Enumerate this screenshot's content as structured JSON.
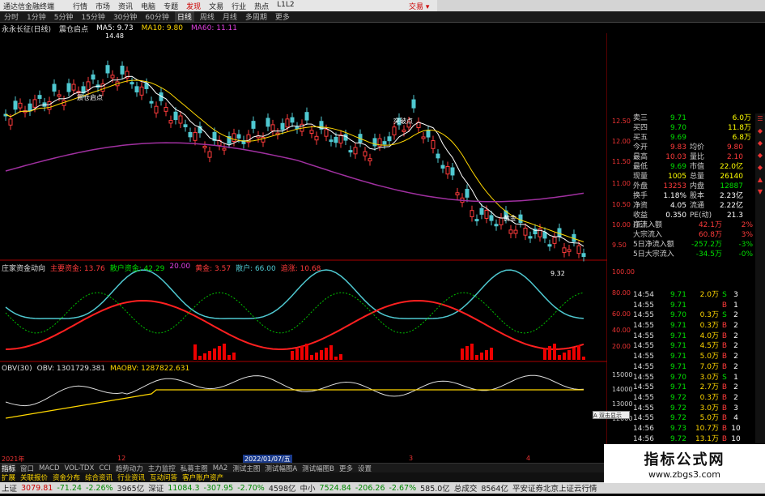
{
  "titlebar": {
    "app_name": "通达信金融终端",
    "menu": [
      "行情",
      "市场",
      "资讯",
      "电脑",
      "专题",
      "发现",
      "文易",
      "行业",
      "热点",
      "L1L2"
    ],
    "menu_active_index": 5,
    "trade_label": "交易 ▾"
  },
  "toolbar": {
    "items": [
      "分时",
      "1分钟",
      "5分钟",
      "15分钟",
      "30分钟",
      "60分钟",
      "日线",
      "周线",
      "月线",
      "多周期",
      "更多"
    ],
    "selected_index": 6
  },
  "ma_line": {
    "stock": "永永长征(日线)",
    "indicator": "震仓启点",
    "ma5": "MA5: 9.73",
    "ma10": "MA10: 9.80",
    "ma60": "MA60: 11.11"
  },
  "price_axis": [
    "12.50",
    "12.00",
    "11.50",
    "11.00",
    "10.50",
    "10.00",
    "9.50"
  ],
  "annotations": {
    "high": "14.48",
    "low": "9.32",
    "label_a": "震仓启点",
    "label_b": "突破点",
    "label_c": "黄金"
  },
  "quote": {
    "rows": [
      {
        "k": "卖三",
        "v": "9.71",
        "v_color": "green",
        "q": "6.0万"
      },
      {
        "k": "买四",
        "v": "9.70",
        "v_color": "green",
        "q": "11.8万"
      },
      {
        "k": "买五",
        "v": "9.69",
        "v_color": "green",
        "q": "6.8万"
      }
    ],
    "stats": [
      {
        "k": "今开",
        "v": "9.83",
        "v_color": "red",
        "k2": "均价",
        "v2": "9.80",
        "v2_color": "red"
      },
      {
        "k": "最高",
        "v": "10.03",
        "v_color": "red",
        "k2": "量比",
        "v2": "2.10",
        "v2_color": "red"
      },
      {
        "k": "最低",
        "v": "9.69",
        "v_color": "green",
        "k2": "市值",
        "v2": "22.0亿",
        "v2_color": "yellow"
      },
      {
        "k": "现量",
        "v": "1005",
        "v_color": "yellow",
        "k2": "总量",
        "v2": "26140",
        "v2_color": "yellow"
      },
      {
        "k": "外盘",
        "v": "13253",
        "v_color": "red",
        "k2": "内盘",
        "v2": "12887",
        "v2_color": "green"
      },
      {
        "k": "换手",
        "v": "1.18%",
        "v_color": "white",
        "k2": "股本",
        "v2": "2.23亿",
        "v2_color": "white"
      },
      {
        "k": "净资",
        "v": "4.05",
        "v_color": "white",
        "k2": "流通",
        "v2": "2.22亿",
        "v2_color": "white"
      },
      {
        "k": "收益(三)",
        "v": "0.350",
        "v_color": "white",
        "k2": "PE(动)",
        "v2": "21.3",
        "v2_color": "white"
      }
    ],
    "flows": [
      {
        "k": "净流入额",
        "v": "42.1万",
        "pct": "2%",
        "color": "red"
      },
      {
        "k": "大宗流入",
        "v": "60.8万",
        "pct": "3%",
        "color": "red"
      },
      {
        "k": "5日净流入额",
        "v": "-257.2万",
        "pct": "-3%",
        "color": "green"
      },
      {
        "k": "5日大宗流入",
        "v": "-34.5万",
        "pct": "-0%",
        "color": "green"
      }
    ]
  },
  "trades": [
    {
      "t": "14:54",
      "p": "9.71",
      "q": "2.0万",
      "d": "S",
      "n": "3"
    },
    {
      "t": "14:55",
      "p": "9.71",
      "q": "",
      "d": "B",
      "n": "1"
    },
    {
      "t": "14:55",
      "p": "9.70",
      "q": "0.3万",
      "d": "S",
      "n": "2"
    },
    {
      "t": "14:55",
      "p": "9.71",
      "q": "0.3万",
      "d": "B",
      "n": "2"
    },
    {
      "t": "14:55",
      "p": "9.71",
      "q": "4.0万",
      "d": "B",
      "n": "2"
    },
    {
      "t": "14:55",
      "p": "9.71",
      "q": "4.5万",
      "d": "B",
      "n": "2"
    },
    {
      "t": "14:55",
      "p": "9.71",
      "q": "5.0万",
      "d": "B",
      "n": "2"
    },
    {
      "t": "14:55",
      "p": "9.71",
      "q": "7.0万",
      "d": "B",
      "n": "2"
    },
    {
      "t": "14:55",
      "p": "9.70",
      "q": "3.0万",
      "d": "S",
      "n": "1"
    },
    {
      "t": "14:55",
      "p": "9.71",
      "q": "2.7万",
      "d": "B",
      "n": "2"
    },
    {
      "t": "14:55",
      "p": "9.72",
      "q": "0.3万",
      "d": "B",
      "n": "2"
    },
    {
      "t": "14:55",
      "p": "9.72",
      "q": "3.0万",
      "d": "B",
      "n": "3"
    },
    {
      "t": "14:55",
      "p": "9.72",
      "q": "5.0万",
      "d": "B",
      "n": "4"
    },
    {
      "t": "14:56",
      "p": "9.73",
      "q": "10.7万",
      "d": "B",
      "n": "10"
    },
    {
      "t": "14:56",
      "p": "9.72",
      "q": "13.1万",
      "d": "B",
      "n": "10"
    },
    {
      "t": "14:56",
      "p": "9.72",
      "q": "17.5万",
      "d": "B",
      "n": "2"
    },
    {
      "t": "14:56",
      "p": "9.72",
      "q": "10.0万",
      "d": "B",
      "n": "2"
    },
    {
      "t": "14:56",
      "p": "9.72",
      "q": "8.5万",
      "d": "B",
      "n": "2"
    },
    {
      "t": "14:56",
      "p": "9.70",
      "q": "18.3万",
      "d": "S",
      "n": "2"
    },
    {
      "t": "14:56",
      "p": "9.71",
      "q": "11.1万",
      "d": "B",
      "n": "4"
    }
  ],
  "fund_panel": {
    "title": "庄家资金动向",
    "main_in_label": "主要资金: 13.76",
    "retail_label": "散户资金: 42.29",
    "v20": "20.00",
    "v_huangjin": "黄金: 3.57",
    "v_sanhu": "散户: 66.00",
    "v_zhuli": "追涨: 10.68",
    "axis": [
      "100.00",
      "80.00",
      "60.00",
      "40.00",
      "20.00"
    ]
  },
  "obv_panel": {
    "title": "OBV(30)",
    "obv": "OBV: 1301729.381",
    "maobv": "MAOBV: 1287822.631",
    "axis": [
      "15000",
      "14000",
      "13000",
      "12000"
    ]
  },
  "dates": {
    "d1": "2021年",
    "d2": "12",
    "d3": "2022/01/07/五",
    "d4": "3",
    "d5": "4"
  },
  "bottom_tabs": [
    "指标",
    "窗口",
    "MACD",
    "VOL-TDX",
    "CCI",
    "趋势动力",
    "主力监控",
    "私募主图",
    "MA2",
    "测试主图",
    "测试幅图A",
    "测试幅图B",
    "更多",
    "设置"
  ],
  "subtabs": [
    "扩展",
    "关联报价",
    "资金分布",
    "综合资讯",
    "行业资讯",
    "互动问答",
    "客户账户资产"
  ],
  "status": {
    "sh_name": "上证",
    "sh_val": "3079.81",
    "sh_chg": "-71.24",
    "sh_pct": "-2.26%",
    "sh_amt": "3965亿",
    "sz_name": "深证",
    "sz_val": "11084.3",
    "sz_chg": "-307.95",
    "sz_pct": "-2.70%",
    "sz_amt": "4598亿",
    "zx_name": "中小",
    "zx_val": "7524.84",
    "zx_chg": "-206.26",
    "zx_pct": "-2.67%",
    "zx_amt": "585.0亿",
    "total_label": "总成交",
    "total_val": "8564亿",
    "server": "平安证券北京上证云行情"
  },
  "popup": "A 双击显示",
  "watermark": {
    "t1": "指标公式网",
    "t2": "www.zbgs3.com"
  }
}
